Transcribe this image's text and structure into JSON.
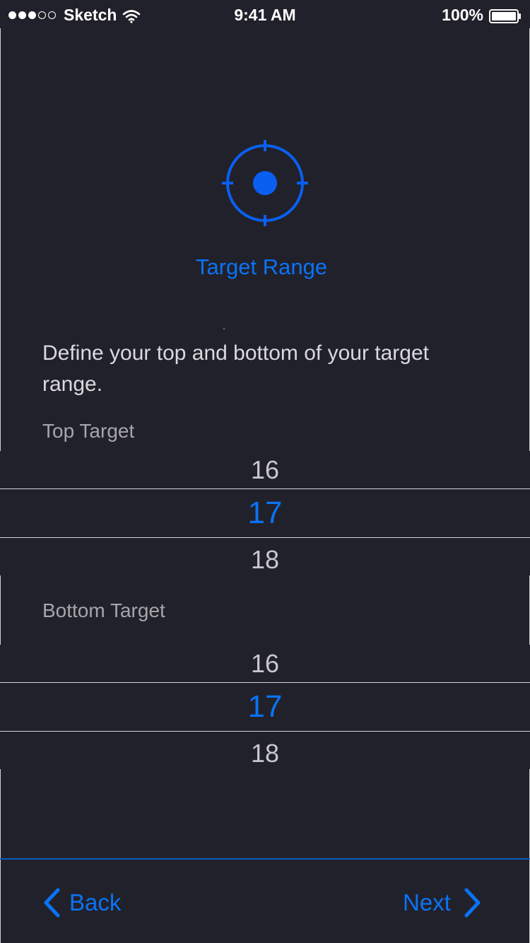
{
  "status_bar": {
    "carrier": "Sketch",
    "time": "9:41 AM",
    "battery": "100%",
    "signal_strength": 3,
    "signal_max": 5
  },
  "header": {
    "icon": "target-icon",
    "title": "Target Range"
  },
  "description": "Define your top and bottom of your target range.",
  "top_target": {
    "label": "Top Target",
    "values": [
      "16",
      "17",
      "18"
    ],
    "selected": "17"
  },
  "bottom_target": {
    "label": "Bottom Target",
    "values": [
      "16",
      "17",
      "18"
    ],
    "selected": "17"
  },
  "footer": {
    "back_label": "Back",
    "next_label": "Next"
  },
  "colors": {
    "background": "#21212b",
    "accent": "#0a73f5",
    "text_primary": "#ffffff",
    "text_secondary": "#a5a5aa"
  }
}
